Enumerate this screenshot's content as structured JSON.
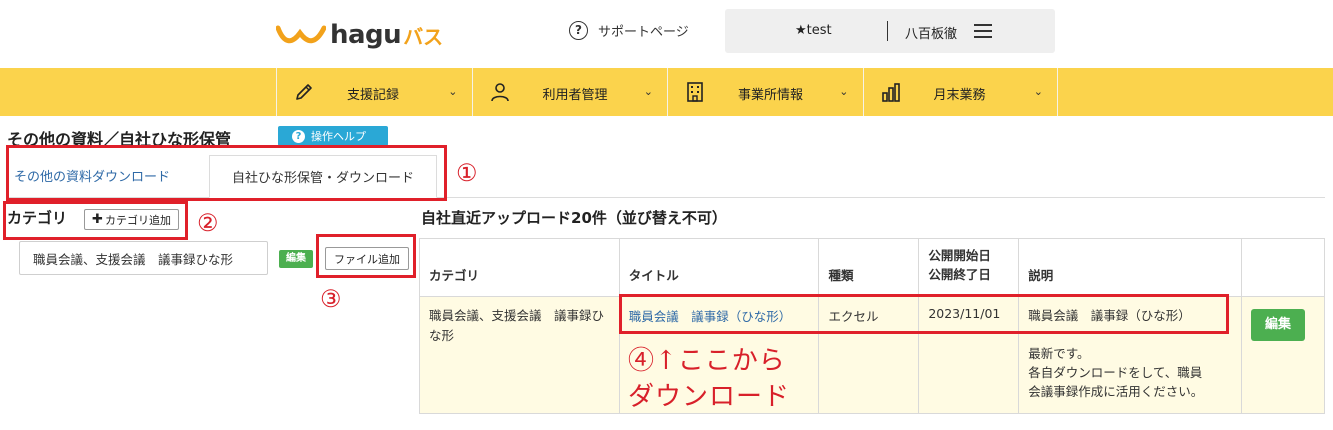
{
  "header": {
    "logo_text": "hagu",
    "logo_accent": "バス",
    "support_label": "サポートページ",
    "office_name": "★test",
    "user_name": "八百板徹"
  },
  "nav": {
    "items": [
      {
        "label": "支援記録",
        "icon": "pencil-icon"
      },
      {
        "label": "利用者管理",
        "icon": "person-icon"
      },
      {
        "label": "事業所情報",
        "icon": "building-icon"
      },
      {
        "label": "月末業務",
        "icon": "bar-chart-icon"
      }
    ]
  },
  "page": {
    "title": "その他の資料／自社ひな形保管",
    "help_label": "操作ヘルプ"
  },
  "tabs": {
    "tab1": "その他の資料ダウンロード",
    "tab2": "自社ひな形保管・ダウンロード"
  },
  "category": {
    "title": "カテゴリ",
    "add_label": "カテゴリ追加",
    "item_label": "職員会議、支援会議　議事録ひな形",
    "edit_label": "編集",
    "file_add_label": "ファイル追加"
  },
  "recent": {
    "title": "自社直近アップロード20件（並び替え不可）",
    "columns": [
      "カテゴリ",
      "タイトル",
      "種類",
      "公開開始日",
      "公開終了日",
      "説明"
    ],
    "rows": [
      {
        "category": "職員会議、支援会議　議事録ひな形",
        "title": "職員会議　議事録（ひな形）",
        "type": "エクセル",
        "start_date": "2023/11/01",
        "end_date": "",
        "desc_line1": "職員会議　議事録（ひな形）",
        "desc_line2": "最新です。",
        "desc_line3": "各自ダウンロードをして、職員",
        "desc_line4": "会議事録作成に活用ください。",
        "edit_label": "編集"
      }
    ]
  },
  "annotations": {
    "n1": "①",
    "n2": "②",
    "n3": "③",
    "n4_line1": "④↑ここから",
    "n4_line2": "ダウンロード",
    "color": "#e0202a"
  },
  "colors": {
    "nav_bg": "#fbd34c",
    "help_bg": "#2aa8d6",
    "edit_bg": "#4caf50",
    "link": "#2f6aa7",
    "row_bg": "#fffbe3"
  }
}
